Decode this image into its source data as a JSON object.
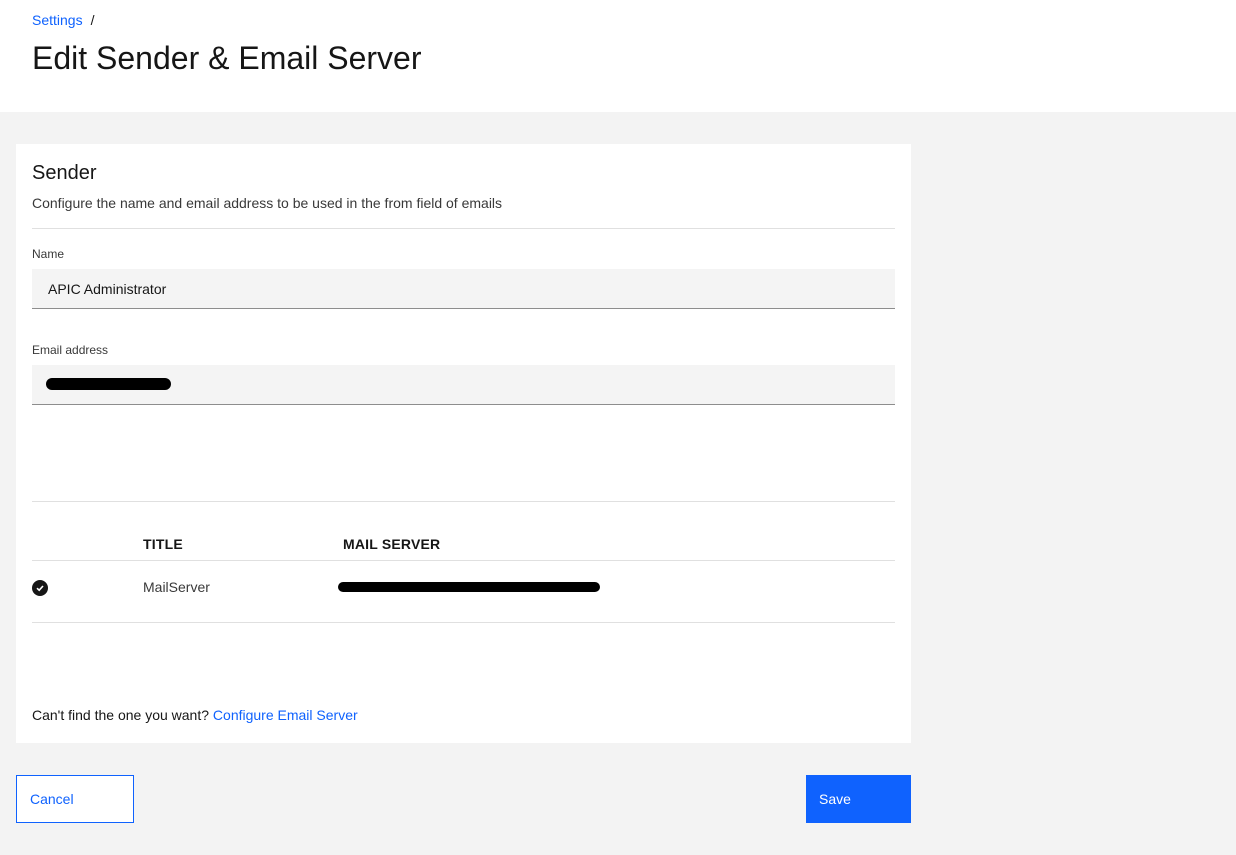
{
  "breadcrumb": {
    "parent": "Settings",
    "separator": "/"
  },
  "page": {
    "title": "Edit Sender & Email Server"
  },
  "sender": {
    "title": "Sender",
    "description": "Configure the name and email address to be used in the from field of emails",
    "name_label": "Name",
    "name_value": "APIC Administrator",
    "email_label": "Email address",
    "email_value": ""
  },
  "mail_table": {
    "headers": {
      "title": "TITLE",
      "mail_server": "MAIL SERVER"
    },
    "rows": [
      {
        "selected": true,
        "title": "MailServer",
        "mail_server": ""
      }
    ]
  },
  "footer": {
    "prompt": "Can't find the one you want?",
    "link": "Configure Email Server"
  },
  "actions": {
    "cancel": "Cancel",
    "save": "Save"
  },
  "colors": {
    "accent": "#0f62fe",
    "page_bg": "#f3f3f3",
    "input_bg": "#f4f4f4"
  },
  "icons": {
    "selected_row": "checkmark-filled-icon"
  }
}
